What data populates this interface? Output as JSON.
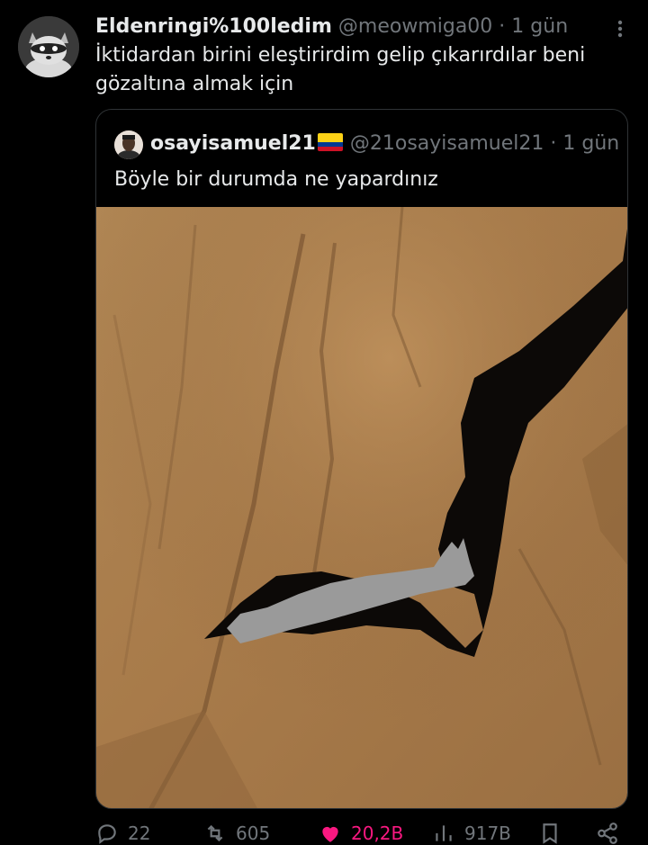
{
  "tweet": {
    "display_name": "Eldenringi%100ledim",
    "handle": "@meowmiga00",
    "separator": "·",
    "time": "1 gün",
    "text": "İktidardan birini eleştirirdim gelip çıkarırdılar beni gözaltına almak için"
  },
  "quoted_tweet": {
    "display_name": "osayisamuel21",
    "flag_icon": "colombia-flag-icon",
    "handle": "@21osayisamuel21",
    "separator": "·",
    "time": "1 gün",
    "text": "Böyle bir durumda ne yapardınız"
  },
  "actions": {
    "reply_count": "22",
    "repost_count": "605",
    "like_count": "20,2B",
    "views_count": "917B"
  },
  "colors": {
    "background": "#000000",
    "text": "#e7e9ea",
    "muted": "#71767b",
    "border": "#2f3336",
    "like": "#f91880"
  }
}
